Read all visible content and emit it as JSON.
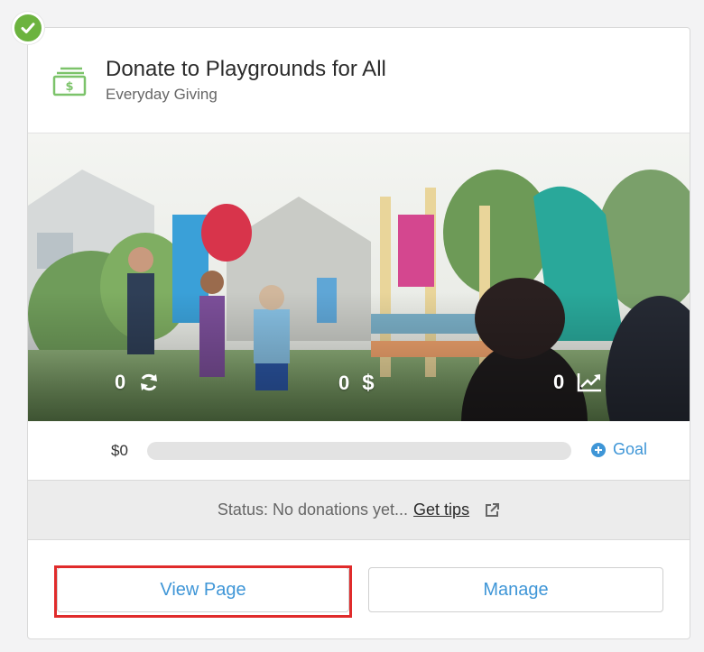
{
  "campaign": {
    "title": "Donate to Playgrounds for All",
    "subtitle": "Everyday Giving",
    "status": "completed"
  },
  "stats": {
    "recurring_count": "0",
    "dollar_count": "0",
    "trend_count": "0"
  },
  "progress": {
    "raised_label": "$0",
    "fraction": 0,
    "goal_label": "Goal"
  },
  "status_bar": {
    "text": "Status: No donations yet...",
    "tips_link": "Get tips"
  },
  "actions": {
    "view_page": "View Page",
    "manage": "Manage"
  },
  "colors": {
    "accent": "#3f96d7",
    "success": "#6cb33f",
    "highlight": "#e02b2b"
  },
  "icons": [
    "check-icon",
    "money-icon",
    "refresh-icon",
    "dollar-icon",
    "chart-trend-icon",
    "plus-circle-icon",
    "external-link-icon"
  ]
}
